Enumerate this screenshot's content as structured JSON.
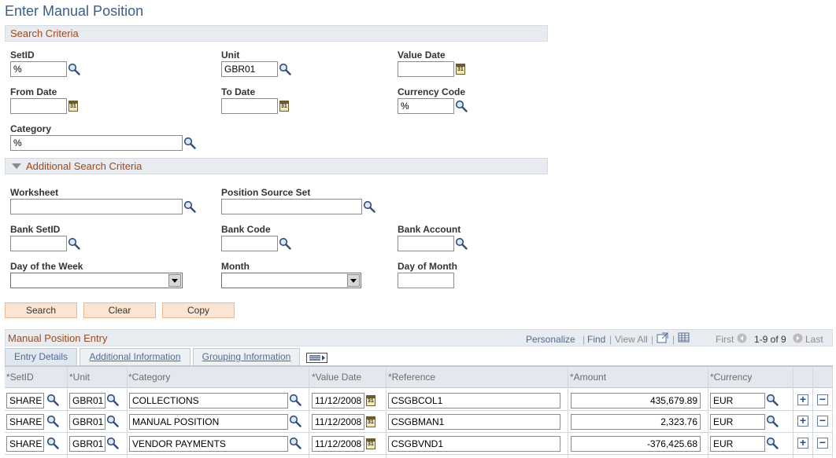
{
  "page": {
    "title": "Enter Manual Position"
  },
  "search_criteria": {
    "header": "Search Criteria",
    "setid_label": "SetID",
    "setid_value": "%",
    "unit_label": "Unit",
    "unit_value": "GBR01",
    "value_date_label": "Value Date",
    "value_date_value": "",
    "from_date_label": "From Date",
    "from_date_value": "",
    "to_date_label": "To Date",
    "to_date_value": "",
    "currency_code_label": "Currency Code",
    "currency_code_value": "%",
    "category_label": "Category",
    "category_value": "%"
  },
  "additional_criteria": {
    "header": "Additional Search Criteria",
    "worksheet_label": "Worksheet",
    "worksheet_value": "",
    "position_source_set_label": "Position Source Set",
    "position_source_set_value": "",
    "bank_setid_label": "Bank SetID",
    "bank_setid_value": "",
    "bank_code_label": "Bank Code",
    "bank_code_value": "",
    "bank_account_label": "Bank Account",
    "bank_account_value": "",
    "day_of_week_label": "Day of the Week",
    "day_of_week_value": "",
    "month_label": "Month",
    "month_value": "",
    "day_of_month_label": "Day of Month",
    "day_of_month_value": ""
  },
  "buttons": {
    "search": "Search",
    "clear": "Clear",
    "copy": "Copy"
  },
  "grid": {
    "title": "Manual Position Entry",
    "personalize": "Personalize",
    "find": "Find",
    "view_all": "View All",
    "first": "First",
    "range": "1-9 of 9",
    "last": "Last",
    "tabs": [
      "Entry Details",
      "Additional Information",
      "Grouping Information"
    ],
    "headers": {
      "setid": "*SetID",
      "unit": "*Unit",
      "category": "*Category",
      "value_date": "*Value Date",
      "reference": "*Reference",
      "amount": "*Amount",
      "currency": "*Currency"
    },
    "rows": [
      {
        "setid": "SHARE",
        "unit": "GBR01",
        "category": "COLLECTIONS",
        "value_date": "11/12/2008",
        "reference": "CSGBCOL1",
        "amount": "435,679.89",
        "currency": "EUR"
      },
      {
        "setid": "SHARE",
        "unit": "GBR01",
        "category": "MANUAL POSITION",
        "value_date": "11/12/2008",
        "reference": "CSGBMAN1",
        "amount": "2,323.76",
        "currency": "EUR"
      },
      {
        "setid": "SHARE",
        "unit": "GBR01",
        "category": "VENDOR PAYMENTS",
        "value_date": "11/12/2008",
        "reference": "CSGBVND1",
        "amount": "-376,425.68",
        "currency": "EUR"
      }
    ]
  },
  "icons": {
    "lookup": "magnifier-icon",
    "calendar": "calendar-icon",
    "add_row": "plus-icon",
    "delete_row": "minus-icon",
    "calendar_day": "31"
  },
  "colors": {
    "title": "#3d5d87",
    "section_text": "#9b4a1f",
    "button_bg": "#fbe5d2",
    "link": "#4d6b94"
  }
}
